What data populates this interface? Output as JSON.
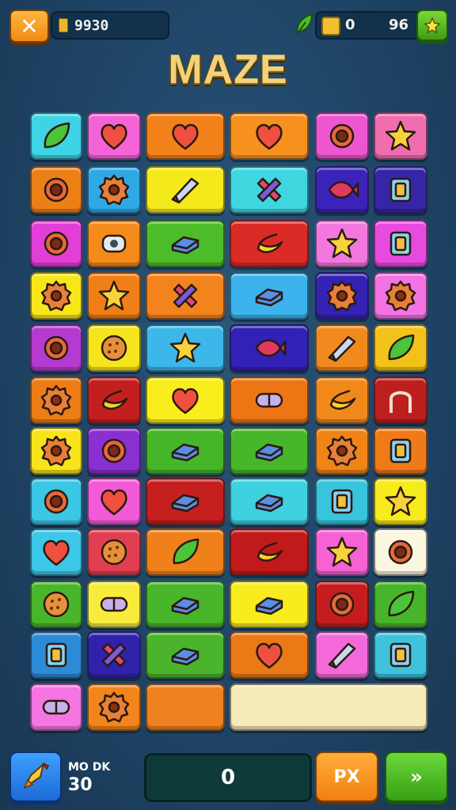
{
  "top_bar": {
    "close_label": "✕",
    "coins_value": "9930",
    "stat_a": "0",
    "stat_b": "96",
    "plus_label": "+"
  },
  "title": "MAZE",
  "tiles": [
    {
      "color": "#3fd3e6",
      "icon": "leaf-icon"
    },
    {
      "color": "#f464d8",
      "icon": "heart-icon"
    },
    {
      "color": "#f3811a",
      "icon": "heart-icon"
    },
    {
      "color": "#f6901f",
      "icon": "heart-icon"
    },
    {
      "color": "#ee56cf",
      "icon": "ring-icon"
    },
    {
      "color": "#ef6eaf",
      "icon": "star-icon"
    },
    {
      "color": "#ec8017",
      "icon": "ring-icon"
    },
    {
      "color": "#2fa8e6",
      "icon": "gear-icon"
    },
    {
      "color": "#f4ea1b",
      "icon": "blade-icon"
    },
    {
      "color": "#3fd6e0",
      "icon": "cross-icon"
    },
    {
      "color": "#3b22b8",
      "icon": "fish-icon"
    },
    {
      "color": "#3526a8",
      "icon": "box-icon"
    },
    {
      "color": "#e23fd6",
      "icon": "ring-icon"
    },
    {
      "color": "#f38a1a",
      "icon": "eye-icon"
    },
    {
      "color": "#4cbc2a",
      "icon": "block-icon"
    },
    {
      "color": "#da2b26",
      "icon": "banana-icon"
    },
    {
      "color": "#f278e0",
      "icon": "star-icon"
    },
    {
      "color": "#e84ae0",
      "icon": "box-icon"
    },
    {
      "color": "#f7e719",
      "icon": "gear-icon"
    },
    {
      "color": "#ef7f16",
      "icon": "star-icon"
    },
    {
      "color": "#f3841d",
      "icon": "cross-icon"
    },
    {
      "color": "#3db3ee",
      "icon": "block-icon"
    },
    {
      "color": "#3422b2",
      "icon": "gear-icon"
    },
    {
      "color": "#f173e4",
      "icon": "gear-icon"
    },
    {
      "color": "#b53ad0",
      "icon": "ring-icon"
    },
    {
      "color": "#f6e51c",
      "icon": "cookie-icon"
    },
    {
      "color": "#3cb7ea",
      "icon": "star-icon"
    },
    {
      "color": "#3121b4",
      "icon": "fish-icon"
    },
    {
      "color": "#f08a1e",
      "icon": "blade-icon"
    },
    {
      "color": "#f1c21a",
      "icon": "leaf-icon"
    },
    {
      "color": "#ed7c15",
      "icon": "gear-icon"
    },
    {
      "color": "#c41f1f",
      "icon": "banana-icon"
    },
    {
      "color": "#f9ee1b",
      "icon": "heart-icon"
    },
    {
      "color": "#ec7613",
      "icon": "capsule-icon"
    },
    {
      "color": "#f0891a",
      "icon": "banana-icon"
    },
    {
      "color": "#bd1f1f",
      "icon": "arch-icon"
    },
    {
      "color": "#f7e41a",
      "icon": "gear-icon"
    },
    {
      "color": "#8a2fd0",
      "icon": "ring-icon"
    },
    {
      "color": "#45b629",
      "icon": "block-icon"
    },
    {
      "color": "#46b72a",
      "icon": "block-icon"
    },
    {
      "color": "#f08417",
      "icon": "gear-icon"
    },
    {
      "color": "#f07a18",
      "icon": "box-icon"
    },
    {
      "color": "#3bc6e6",
      "icon": "ring-icon"
    },
    {
      "color": "#f35ad8",
      "icon": "heart-icon"
    },
    {
      "color": "#c61f1f",
      "icon": "block-icon"
    },
    {
      "color": "#3fd1e0",
      "icon": "block-icon"
    },
    {
      "color": "#37c4dc",
      "icon": "box-icon"
    },
    {
      "color": "#f7ea1d",
      "icon": "star-icon"
    },
    {
      "color": "#3dc7e8",
      "icon": "heart-icon"
    },
    {
      "color": "#e23e52",
      "icon": "cookie-icon"
    },
    {
      "color": "#f0811a",
      "icon": "leaf-icon"
    },
    {
      "color": "#c21a1a",
      "icon": "banana-icon"
    },
    {
      "color": "#f462d4",
      "icon": "star-icon"
    },
    {
      "color": "#fbf6e0",
      "icon": "ring-icon"
    },
    {
      "color": "#49b52a",
      "icon": "cookie-icon"
    },
    {
      "color": "#f7ec3c",
      "icon": "capsule-icon"
    },
    {
      "color": "#48b52a",
      "icon": "block-icon"
    },
    {
      "color": "#f9ec1e",
      "icon": "block-icon"
    },
    {
      "color": "#c51d1d",
      "icon": "ring-icon"
    },
    {
      "color": "#47b52a",
      "icon": "leaf-icon"
    },
    {
      "color": "#2b8bd6",
      "icon": "box-icon"
    },
    {
      "color": "#3022ad",
      "icon": "cross-icon"
    },
    {
      "color": "#49b42c",
      "icon": "block-icon"
    },
    {
      "color": "#ea7a16",
      "icon": "heart-icon"
    },
    {
      "color": "#f369da",
      "icon": "blade-icon"
    },
    {
      "color": "#3fc2de",
      "icon": "box-icon"
    },
    {
      "color": "#f575e2",
      "icon": "capsule-icon"
    },
    {
      "color": "#f2851b",
      "icon": "gear-icon"
    },
    {
      "color": "#ef8120",
      "icon": "empty"
    },
    {
      "color": "#f5eab8",
      "icon": "empty"
    }
  ],
  "bottom_bar": {
    "mode_label": "MO DK",
    "mode_value": "30",
    "score_value": "0",
    "orange_label": "PX",
    "next_label": "»"
  }
}
